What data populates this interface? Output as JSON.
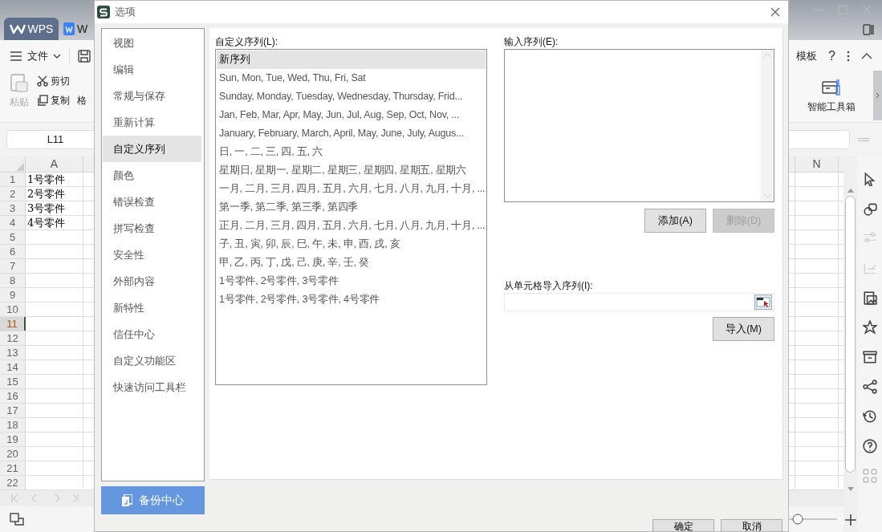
{
  "app": {
    "tabs": [
      {
        "label": "WPS",
        "selected": true
      },
      {
        "label": "W",
        "selected": false
      }
    ],
    "menu": {
      "file": "文件",
      "template": "模板",
      "help": "?"
    },
    "ribbon": {
      "paste": "粘贴",
      "cut": "剪切",
      "copy": "复制",
      "format": "格",
      "toolbox": "智能工具箱"
    },
    "name_box": "L11",
    "columns": [
      {
        "label": "A"
      },
      {
        "label": "N"
      }
    ],
    "rows": [
      {
        "number": "1",
        "cell": "1号零件",
        "selected": false
      },
      {
        "number": "2",
        "cell": "2号零件",
        "selected": false
      },
      {
        "number": "3",
        "cell": "3号零件",
        "selected": false
      },
      {
        "number": "4",
        "cell": "4号零件",
        "selected": false
      },
      {
        "number": "5",
        "selected": false
      },
      {
        "number": "6",
        "selected": false
      },
      {
        "number": "7",
        "selected": false
      },
      {
        "number": "8",
        "selected": false
      },
      {
        "number": "9",
        "selected": false
      },
      {
        "number": "10",
        "selected": false
      },
      {
        "number": "11",
        "selected": true
      },
      {
        "number": "12",
        "selected": false
      },
      {
        "number": "13",
        "selected": false
      },
      {
        "number": "14",
        "selected": false
      },
      {
        "number": "15",
        "selected": false
      },
      {
        "number": "16",
        "selected": false
      },
      {
        "number": "17",
        "selected": false
      },
      {
        "number": "18",
        "selected": false
      },
      {
        "number": "19",
        "selected": false
      },
      {
        "number": "20",
        "selected": false
      },
      {
        "number": "21",
        "selected": false
      },
      {
        "number": "22",
        "selected": false
      }
    ]
  },
  "dialog": {
    "title": "选项",
    "nav": [
      {
        "label": "视图",
        "selected": false
      },
      {
        "label": "编辑",
        "selected": false
      },
      {
        "label": "常规与保存",
        "selected": false
      },
      {
        "label": "重新计算",
        "selected": false
      },
      {
        "label": "自定义序列",
        "selected": true
      },
      {
        "label": "颜色",
        "selected": false
      },
      {
        "label": "错误检查",
        "selected": false
      },
      {
        "label": "拼写检查",
        "selected": false
      },
      {
        "label": "安全性",
        "selected": false
      },
      {
        "label": "外部内容",
        "selected": false
      },
      {
        "label": "新特性",
        "selected": false
      },
      {
        "label": "信任中心",
        "selected": false
      },
      {
        "label": "自定义功能区",
        "selected": false
      },
      {
        "label": "快速访问工具栏",
        "selected": false
      }
    ],
    "backup_button": "备份中心",
    "list_label": "自定义序列(L):",
    "sequences": [
      {
        "text": "新序列",
        "selected": true
      },
      {
        "text": "Sun, Mon, Tue, Wed, Thu, Fri, Sat",
        "selected": false
      },
      {
        "text": "Sunday, Monday, Tuesday, Wednesday, Thursday, Frid...",
        "selected": false
      },
      {
        "text": "Jan, Feb, Mar, Apr, May, Jun, Jul, Aug, Sep, Oct, Nov, ...",
        "selected": false
      },
      {
        "text": "January, February, March, April, May, June, July, Augus...",
        "selected": false
      },
      {
        "text": "日, 一, 二, 三, 四, 五, 六",
        "selected": false
      },
      {
        "text": "星期日, 星期一, 星期二, 星期三, 星期四, 星期五, 星期六",
        "selected": false
      },
      {
        "text": "一月, 二月, 三月, 四月, 五月, 六月, 七月, 八月, 九月, 十月, ...",
        "selected": false
      },
      {
        "text": "第一季, 第二季, 第三季, 第四季",
        "selected": false
      },
      {
        "text": "正月, 二月, 三月, 四月, 五月, 六月, 七月, 八月, 九月, 十月, ...",
        "selected": false
      },
      {
        "text": "子, 丑, 寅, 卯, 辰, 巳, 午, 未, 申, 酉, 戌, 亥",
        "selected": false
      },
      {
        "text": "甲, 乙, 丙, 丁, 戊, 己, 庚, 辛, 壬, 癸",
        "selected": false
      },
      {
        "text": "1号零件, 2号零件, 3号零件",
        "selected": false
      },
      {
        "text": "1号零件, 2号零件, 3号零件, 4号零件",
        "selected": false
      }
    ],
    "input_label": "输入序列(E):",
    "add_button": {
      "label": "添加(A)",
      "disabled": false
    },
    "delete_button": {
      "label": "删除(D)",
      "disabled": true
    },
    "import_label": "从单元格导入序列(I):",
    "import_button": {
      "label": "导入(M)",
      "disabled": false
    },
    "ok_button": "确定",
    "cancel_button": "取消"
  }
}
